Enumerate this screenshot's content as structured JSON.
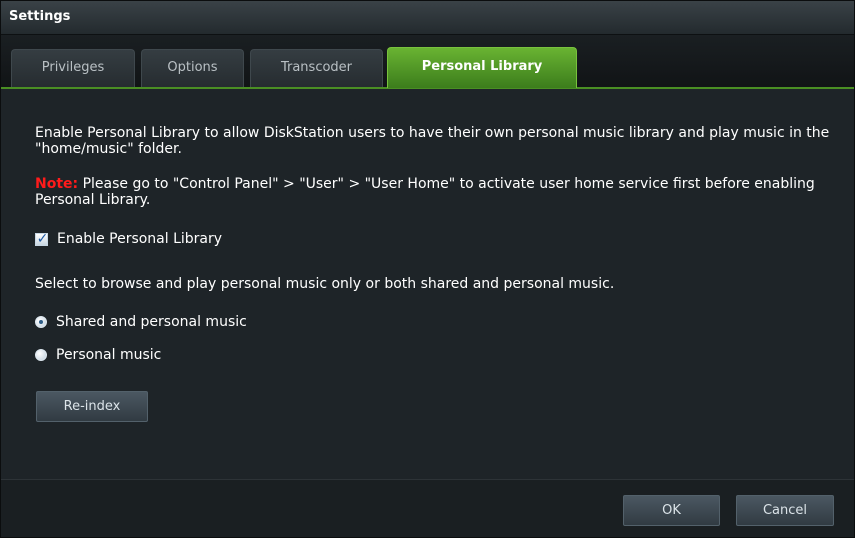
{
  "window": {
    "title": "Settings"
  },
  "tabs": [
    {
      "label": "Privileges",
      "active": false
    },
    {
      "label": "Options",
      "active": false
    },
    {
      "label": "Transcoder",
      "active": false
    },
    {
      "label": "Personal Library",
      "active": true
    }
  ],
  "content": {
    "description": "Enable Personal Library to allow DiskStation users to have their own personal music library and play music in the \"home/music\" folder.",
    "note_label": "Note:",
    "note_text": " Please go to \"Control Panel\" > \"User\" > \"User Home\" to activate user home service first before enabling Personal Library.",
    "enable_checkbox": {
      "label": "Enable Personal Library",
      "checked": true
    },
    "select_text": "Select to browse and play personal music only or both shared and personal music.",
    "radio_options": [
      {
        "label": "Shared and personal music",
        "checked": true
      },
      {
        "label": "Personal music",
        "checked": false
      }
    ],
    "reindex_label": "Re-index"
  },
  "footer": {
    "ok_label": "OK",
    "cancel_label": "Cancel"
  },
  "colors": {
    "accent_green": "#4a8f23",
    "note_red": "#ff1b1b",
    "background": "#1e2428"
  }
}
